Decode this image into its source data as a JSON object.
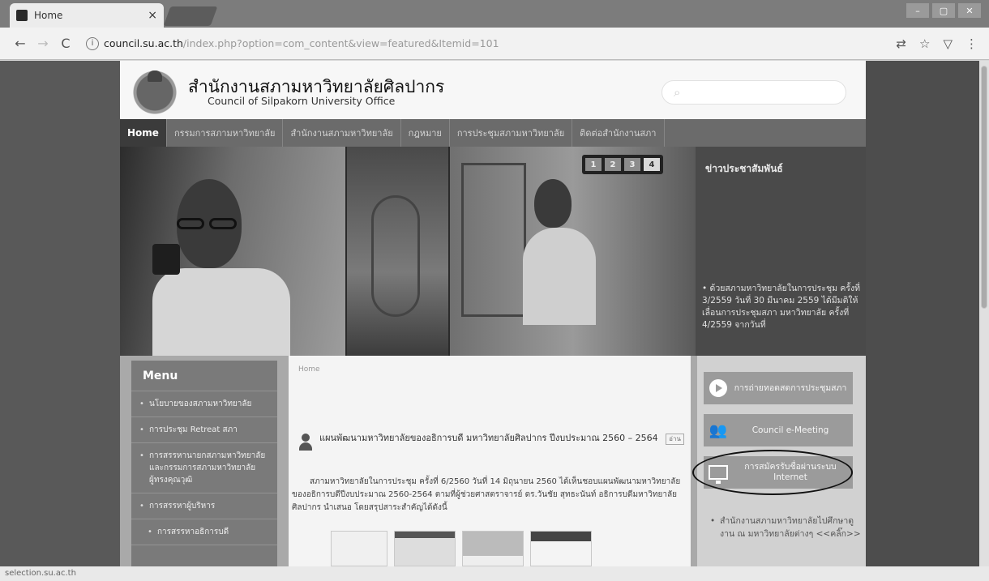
{
  "browser": {
    "tab_title": "Home",
    "tab_close": "×",
    "url_host": "council.su.ac.th",
    "url_path": "/index.php?option=com_content&view=featured&Itemid=101",
    "status_url": "selection.su.ac.th"
  },
  "site": {
    "title_th": "สำนักงานสภามหาวิทยาลัยศิลปากร",
    "title_en": "Council of Silpakorn University Office"
  },
  "nav": [
    {
      "label": "Home"
    },
    {
      "label": "กรรมการสภามหาวิทยาลัย"
    },
    {
      "label": "สำนักงานสภามหาวิทยาลัย"
    },
    {
      "label": "กฎหมาย"
    },
    {
      "label": "การประชุมสภามหาวิทยาลัย"
    },
    {
      "label": "ติดต่อสำนักงานสภา"
    }
  ],
  "slideshow": {
    "pages": [
      "1",
      "2",
      "3",
      "4"
    ],
    "active_page": "4"
  },
  "news": {
    "title": "ข่าวประชาสัมพันธ์",
    "item": "• ด้วยสภามหาวิทยาลัยในการประชุม ครั้งที่ 3/2559 วันที่ 30 มีนาคม 2559 ได้มีมติให้เลื่อนการประชุมสภา มหาวิทยาลัย ครั้งที่ 4/2559 จากวันที่"
  },
  "menu": {
    "title": "Menu",
    "items": [
      {
        "label": "นโยบายของสภามหาวิทยาลัย"
      },
      {
        "label": "การประชุม Retreat สภา"
      },
      {
        "label": "การสรรหานายกสภามหาวิทยาลัยและกรรมการสภามหาวิทยาลัยผู้ทรงคุณวุฒิ"
      },
      {
        "label": "การสรรหาผู้บริหาร"
      },
      {
        "label": "การสรรหาอธิการบดี"
      }
    ]
  },
  "content": {
    "breadcrumb": "Home",
    "article_title": "แผนพัฒนามหาวิทยาลัยของอธิการบดี มหาวิทยาลัยศิลปากร ปีงบประมาณ 2560 – 2564",
    "badge": "อ่าน",
    "article_body": "สภามหาวิทยาลัยในการประชุม ครั้งที่ 6/2560 วันที่ 14 มิถุนายน 2560 ได้เห็นชอบแผนพัฒนามหาวิทยาลัยของอธิการบดีปีงบประมาณ 2560-2564 ตามที่ผู้ช่วยศาสตราจารย์ ดร.วันชัย สุทธะนันท์ อธิการบดีมหาวิทยาลัยศิลปากร นำเสนอ โดยสรุปสาระสำคัญได้ดังนี้"
  },
  "rightcol": {
    "buttons": [
      {
        "label": "การถ่ายทอดสดการประชุมสภา",
        "icon": "play-icon"
      },
      {
        "label": "Council e-Meeting",
        "icon": "people-icon"
      },
      {
        "label": "การสมัครรับชื่อผ่านระบบ Internet",
        "icon": "monitor-icon"
      }
    ],
    "news_item": "สำนักงานสภามหาวิทยาลัยไปศึกษาดูงาน ณ มหาวิทยาลัยต่างๆ <<คลิ๊ก>>"
  },
  "colors": {
    "nav_bg": "#6b6b6b",
    "nav_active": "#3b3b3b",
    "menu_bg": "#7a7a7a",
    "button_bg": "#9b9b9b"
  }
}
